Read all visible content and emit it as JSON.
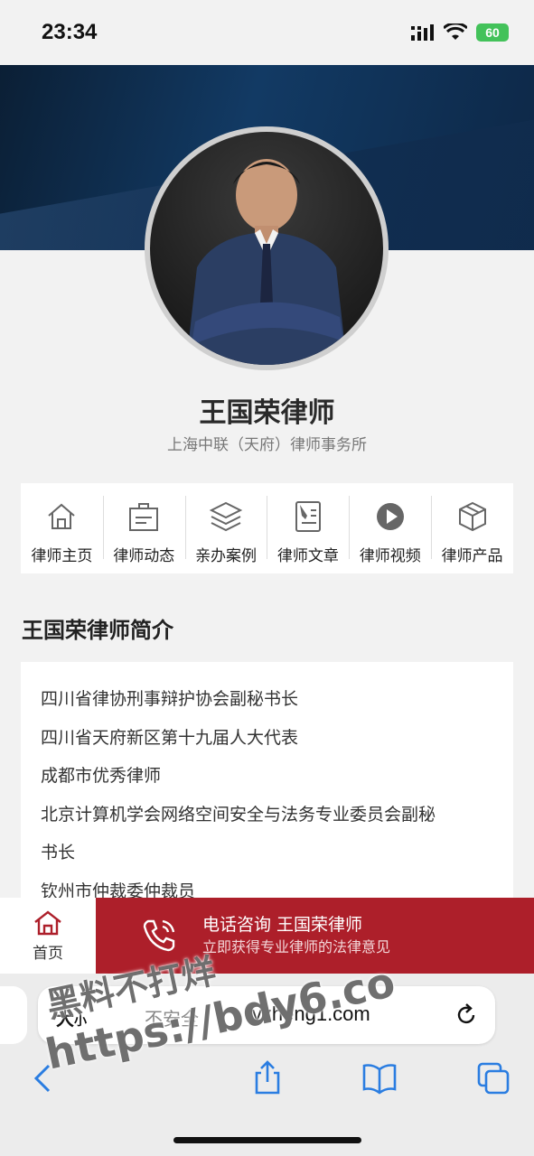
{
  "status_bar": {
    "time": "23:34",
    "battery": "60"
  },
  "profile": {
    "name": "王国荣律师",
    "firm": "上海中联（天府）律师事务所"
  },
  "nav": [
    {
      "label": "律师主页",
      "icon": "home-icon"
    },
    {
      "label": "律师动态",
      "icon": "news-icon"
    },
    {
      "label": "亲办案例",
      "icon": "layers-icon"
    },
    {
      "label": "律师文章",
      "icon": "document-pen-icon"
    },
    {
      "label": "律师视频",
      "icon": "play-icon"
    },
    {
      "label": "律师产品",
      "icon": "box-icon"
    }
  ],
  "intro": {
    "title": "王国荣律师简介",
    "lines": [
      "四川省律协刑事辩护协会副秘书长",
      "四川省天府新区第十九届人大代表",
      "成都市优秀律师",
      "北京计算机学会网络空间安全与法务专业委员会副秘",
      "书长",
      "钦州市仲裁委仲裁员"
    ]
  },
  "bottom_bar": {
    "home_label": "首页",
    "consult_title": "电话咨询 王国荣律师",
    "consult_subtitle": "立即获得专业律师的法律意见",
    "accent": "#ad1f2a"
  },
  "browser": {
    "text_size": "大",
    "text_size_small": "小",
    "security": "不安全",
    "url": "lvzheng1.com"
  },
  "watermark": {
    "line1": "黑料不打烊",
    "line2": "https://bdy6.co"
  }
}
